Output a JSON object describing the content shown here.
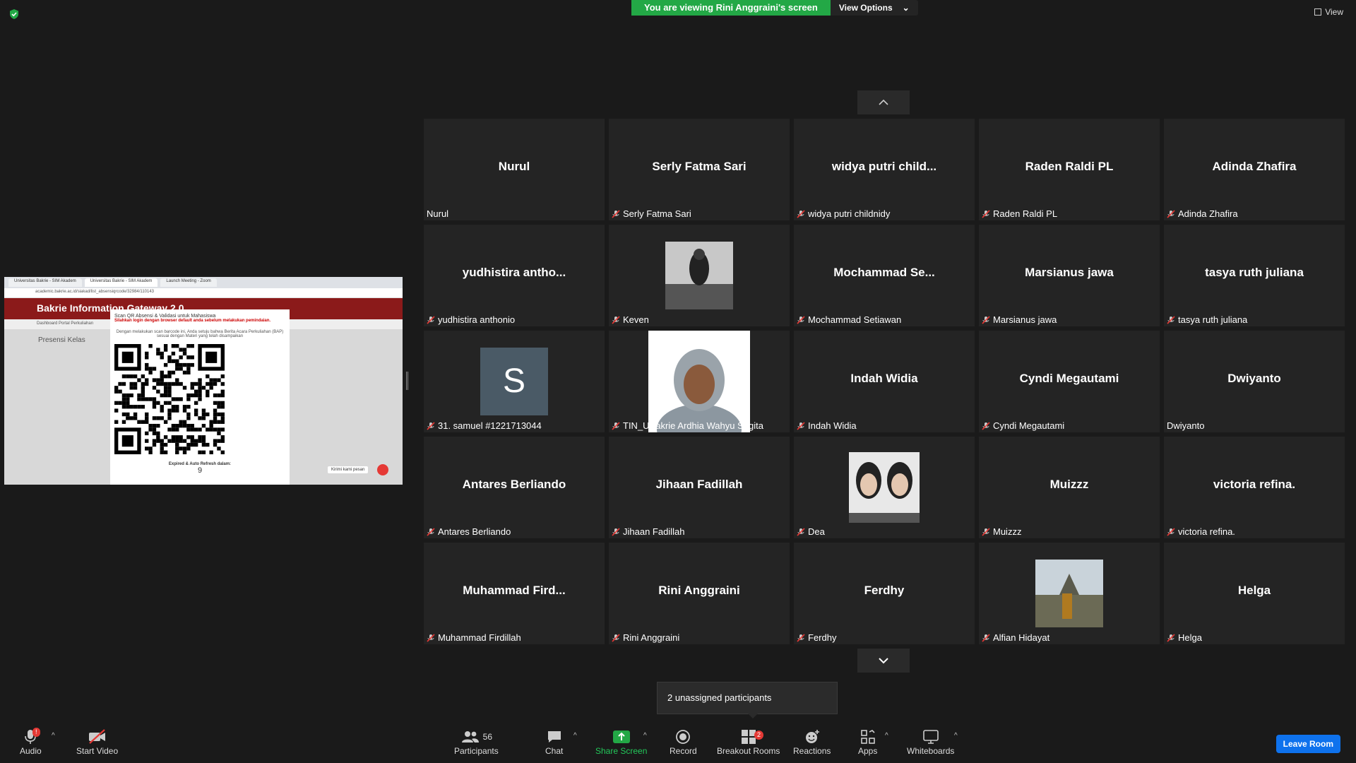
{
  "banner": {
    "viewing_text": "You are viewing Rini Anggraini's screen",
    "view_options": "View Options"
  },
  "top_right": {
    "view_label": "View"
  },
  "shared_screen": {
    "tabs": [
      "Universitas Bakrie - SIM Akadem",
      "Universitas Bakrie - SIM Akadem",
      "Launch Meeting - Zoom"
    ],
    "url": "academic.bakrie.ac.id/siakad/list_absensiqrcode/32984/110143",
    "site_title": "Bakrie Information Gateway 2.0",
    "nav_items": "Dashboard    Portal    Perkuliahan",
    "page_heading": "Presensi Kelas",
    "modal_title": "Scan QR Absensi & Validasi untuk Mahasiswa",
    "modal_warning": "Silahkan login dengan browser default anda sebelum melakukan pemindaian.",
    "modal_body": "Dengan melakukan scan barcode ini, Anda setuju bahwa Berita Acara Perkuliahan (BAP) sesuai dengan Materi yang telah disampaikan",
    "expire_label": "Expired & Auto Refresh dalam:",
    "countdown": "9",
    "chat_bubble": "Kirimi kami pesan"
  },
  "gallery": {
    "tiles": [
      {
        "big": "Nurul",
        "name": "Nurul",
        "muted": false
      },
      {
        "big": "Serly Fatma Sari",
        "name": "Serly Fatma Sari",
        "muted": true
      },
      {
        "big": "widya putri child...",
        "name": "widya putri childnidy",
        "muted": true
      },
      {
        "big": "Raden Raldi PL",
        "name": "Raden Raldi PL",
        "muted": true
      },
      {
        "big": "Adinda Zhafira",
        "name": "Adinda Zhafira",
        "muted": true
      },
      {
        "big": "yudhistira antho...",
        "name": "yudhistira anthonio",
        "muted": true
      },
      {
        "big": "",
        "name": "Keven",
        "muted": true,
        "photo": "gym"
      },
      {
        "big": "Mochammad Se...",
        "name": "Mochammad Setiawan",
        "muted": true
      },
      {
        "big": "Marsianus jawa",
        "name": "Marsianus jawa",
        "muted": true
      },
      {
        "big": "tasya ruth juliana",
        "name": "tasya ruth juliana",
        "muted": true
      },
      {
        "big": "",
        "name": "31. samuel #1221713044",
        "muted": true,
        "avatar_letter": "S"
      },
      {
        "big": "",
        "name": "TIN_UBakrie Ardhia Wahyu Sagita",
        "muted": true,
        "photo": "portrait"
      },
      {
        "big": "Indah Widia",
        "name": "Indah Widia",
        "muted": true
      },
      {
        "big": "Cyndi Megautami",
        "name": "Cyndi Megautami",
        "muted": true
      },
      {
        "big": "Dwiyanto",
        "name": "Dwiyanto",
        "muted": false
      },
      {
        "big": "Antares Berliando",
        "name": "Antares Berliando",
        "muted": true
      },
      {
        "big": "Jihaan Fadillah",
        "name": "Jihaan Fadillah",
        "muted": true
      },
      {
        "big": "",
        "name": "Dea",
        "muted": true,
        "photo": "twins"
      },
      {
        "big": "Muizzz",
        "name": "Muizzz",
        "muted": true
      },
      {
        "big": "victoria refina.",
        "name": "victoria refina.",
        "muted": true
      },
      {
        "big": "Muhammad Fird...",
        "name": "Muhammad Firdillah",
        "muted": true
      },
      {
        "big": "Rini Anggraini",
        "name": "Rini Anggraini",
        "muted": true
      },
      {
        "big": "Ferdhy",
        "name": "Ferdhy",
        "muted": true
      },
      {
        "big": "",
        "name": "Alfian Hidayat",
        "muted": true,
        "photo": "temple"
      },
      {
        "big": "Helga",
        "name": "Helga",
        "muted": true
      }
    ]
  },
  "unassigned_text": "2 unassigned participants",
  "toolbar": {
    "audio": "Audio",
    "audio_badge": "!",
    "start_video": "Start Video",
    "participants": "Participants",
    "participants_count": "56",
    "chat": "Chat",
    "share_screen": "Share Screen",
    "record": "Record",
    "breakout": "Breakout Rooms",
    "breakout_badge": "2",
    "reactions": "Reactions",
    "apps": "Apps",
    "whiteboards": "Whiteboards",
    "leave": "Leave Room"
  },
  "colors": {
    "share_green": "#23a846",
    "leave_blue": "#0e72ed",
    "mute_red": "#e53935"
  }
}
